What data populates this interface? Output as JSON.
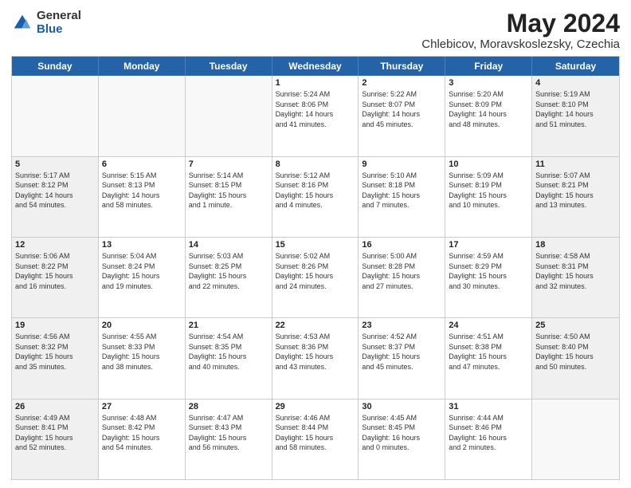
{
  "logo": {
    "general": "General",
    "blue": "Blue"
  },
  "title": "May 2024",
  "location": "Chlebicov, Moravskoslezsky, Czechia",
  "days": [
    "Sunday",
    "Monday",
    "Tuesday",
    "Wednesday",
    "Thursday",
    "Friday",
    "Saturday"
  ],
  "weeks": [
    [
      {
        "day": "",
        "info": "",
        "empty": true
      },
      {
        "day": "",
        "info": "",
        "empty": true
      },
      {
        "day": "",
        "info": "",
        "empty": true
      },
      {
        "day": "1",
        "info": "Sunrise: 5:24 AM\nSunset: 8:06 PM\nDaylight: 14 hours\nand 41 minutes."
      },
      {
        "day": "2",
        "info": "Sunrise: 5:22 AM\nSunset: 8:07 PM\nDaylight: 14 hours\nand 45 minutes."
      },
      {
        "day": "3",
        "info": "Sunrise: 5:20 AM\nSunset: 8:09 PM\nDaylight: 14 hours\nand 48 minutes."
      },
      {
        "day": "4",
        "info": "Sunrise: 5:19 AM\nSunset: 8:10 PM\nDaylight: 14 hours\nand 51 minutes.",
        "shaded": true
      }
    ],
    [
      {
        "day": "5",
        "info": "Sunrise: 5:17 AM\nSunset: 8:12 PM\nDaylight: 14 hours\nand 54 minutes.",
        "shaded": true
      },
      {
        "day": "6",
        "info": "Sunrise: 5:15 AM\nSunset: 8:13 PM\nDaylight: 14 hours\nand 58 minutes."
      },
      {
        "day": "7",
        "info": "Sunrise: 5:14 AM\nSunset: 8:15 PM\nDaylight: 15 hours\nand 1 minute."
      },
      {
        "day": "8",
        "info": "Sunrise: 5:12 AM\nSunset: 8:16 PM\nDaylight: 15 hours\nand 4 minutes."
      },
      {
        "day": "9",
        "info": "Sunrise: 5:10 AM\nSunset: 8:18 PM\nDaylight: 15 hours\nand 7 minutes."
      },
      {
        "day": "10",
        "info": "Sunrise: 5:09 AM\nSunset: 8:19 PM\nDaylight: 15 hours\nand 10 minutes."
      },
      {
        "day": "11",
        "info": "Sunrise: 5:07 AM\nSunset: 8:21 PM\nDaylight: 15 hours\nand 13 minutes.",
        "shaded": true
      }
    ],
    [
      {
        "day": "12",
        "info": "Sunrise: 5:06 AM\nSunset: 8:22 PM\nDaylight: 15 hours\nand 16 minutes.",
        "shaded": true
      },
      {
        "day": "13",
        "info": "Sunrise: 5:04 AM\nSunset: 8:24 PM\nDaylight: 15 hours\nand 19 minutes."
      },
      {
        "day": "14",
        "info": "Sunrise: 5:03 AM\nSunset: 8:25 PM\nDaylight: 15 hours\nand 22 minutes."
      },
      {
        "day": "15",
        "info": "Sunrise: 5:02 AM\nSunset: 8:26 PM\nDaylight: 15 hours\nand 24 minutes."
      },
      {
        "day": "16",
        "info": "Sunrise: 5:00 AM\nSunset: 8:28 PM\nDaylight: 15 hours\nand 27 minutes."
      },
      {
        "day": "17",
        "info": "Sunrise: 4:59 AM\nSunset: 8:29 PM\nDaylight: 15 hours\nand 30 minutes."
      },
      {
        "day": "18",
        "info": "Sunrise: 4:58 AM\nSunset: 8:31 PM\nDaylight: 15 hours\nand 32 minutes.",
        "shaded": true
      }
    ],
    [
      {
        "day": "19",
        "info": "Sunrise: 4:56 AM\nSunset: 8:32 PM\nDaylight: 15 hours\nand 35 minutes.",
        "shaded": true
      },
      {
        "day": "20",
        "info": "Sunrise: 4:55 AM\nSunset: 8:33 PM\nDaylight: 15 hours\nand 38 minutes."
      },
      {
        "day": "21",
        "info": "Sunrise: 4:54 AM\nSunset: 8:35 PM\nDaylight: 15 hours\nand 40 minutes."
      },
      {
        "day": "22",
        "info": "Sunrise: 4:53 AM\nSunset: 8:36 PM\nDaylight: 15 hours\nand 43 minutes."
      },
      {
        "day": "23",
        "info": "Sunrise: 4:52 AM\nSunset: 8:37 PM\nDaylight: 15 hours\nand 45 minutes."
      },
      {
        "day": "24",
        "info": "Sunrise: 4:51 AM\nSunset: 8:38 PM\nDaylight: 15 hours\nand 47 minutes."
      },
      {
        "day": "25",
        "info": "Sunrise: 4:50 AM\nSunset: 8:40 PM\nDaylight: 15 hours\nand 50 minutes.",
        "shaded": true
      }
    ],
    [
      {
        "day": "26",
        "info": "Sunrise: 4:49 AM\nSunset: 8:41 PM\nDaylight: 15 hours\nand 52 minutes.",
        "shaded": true
      },
      {
        "day": "27",
        "info": "Sunrise: 4:48 AM\nSunset: 8:42 PM\nDaylight: 15 hours\nand 54 minutes."
      },
      {
        "day": "28",
        "info": "Sunrise: 4:47 AM\nSunset: 8:43 PM\nDaylight: 15 hours\nand 56 minutes."
      },
      {
        "day": "29",
        "info": "Sunrise: 4:46 AM\nSunset: 8:44 PM\nDaylight: 15 hours\nand 58 minutes."
      },
      {
        "day": "30",
        "info": "Sunrise: 4:45 AM\nSunset: 8:45 PM\nDaylight: 16 hours\nand 0 minutes."
      },
      {
        "day": "31",
        "info": "Sunrise: 4:44 AM\nSunset: 8:46 PM\nDaylight: 16 hours\nand 2 minutes."
      },
      {
        "day": "",
        "info": "",
        "empty": true
      }
    ]
  ]
}
